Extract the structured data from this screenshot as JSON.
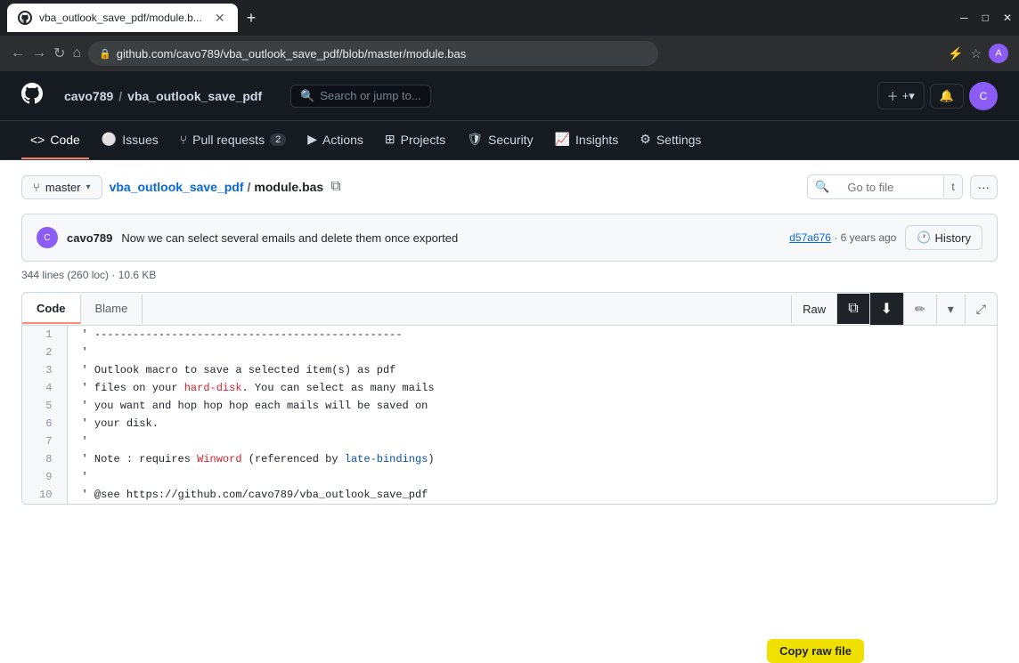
{
  "browser": {
    "tab_title": "vba_outlook_save_pdf/module.b...",
    "url": "github.com/cavo789/vba_outlook_save_pdf/blob/master/module.bas",
    "new_tab_label": "+"
  },
  "github": {
    "logo": "⬤",
    "breadcrumb_user": "cavo789",
    "breadcrumb_sep": "/",
    "breadcrumb_repo": "vba_outlook_save_pdf",
    "search_placeholder": "Search or jump to...",
    "header_icons": {
      "plus_label": "+▾",
      "bell_label": "🔔"
    }
  },
  "nav": {
    "items": [
      {
        "id": "code",
        "label": "Code",
        "active": true,
        "badge": null
      },
      {
        "id": "issues",
        "label": "Issues",
        "active": false,
        "badge": null
      },
      {
        "id": "pull_requests",
        "label": "Pull requests",
        "active": false,
        "badge": "2"
      },
      {
        "id": "actions",
        "label": "Actions",
        "active": false,
        "badge": null
      },
      {
        "id": "projects",
        "label": "Projects",
        "active": false,
        "badge": null
      },
      {
        "id": "security",
        "label": "Security",
        "active": false,
        "badge": null
      },
      {
        "id": "insights",
        "label": "Insights",
        "active": false,
        "badge": null
      },
      {
        "id": "settings",
        "label": "Settings",
        "active": false,
        "badge": null
      }
    ]
  },
  "file_nav": {
    "branch": "master",
    "repo_name": "vba_outlook_save_pdf",
    "file_name": "module.bas",
    "go_to_file_placeholder": "Go to file",
    "go_to_file_shortcut": "t"
  },
  "commit": {
    "author": "cavo789",
    "message": "Now we can select several emails and delete them once exported",
    "hash": "d57a676",
    "age": "6 years ago",
    "history_label": "History"
  },
  "file_meta": {
    "stats": "344 lines (260 loc) · 10.6 KB"
  },
  "toolbar": {
    "raw_label": "Raw",
    "copy_label": "📋",
    "download_label": "⬇",
    "edit_label": "✏",
    "more_label": "▾",
    "expand_label": "⤢",
    "code_tab": "Code",
    "blame_tab": "Blame",
    "copy_raw_tooltip": "Copy raw file"
  },
  "code_lines": [
    {
      "num": 1,
      "code": "' ------------------------------------------------"
    },
    {
      "num": 2,
      "code": "'"
    },
    {
      "num": 3,
      "code": "' Outlook macro to save a selected item(s) as pdf"
    },
    {
      "num": 4,
      "code": "' files on your hard-disk. You can select as many mails"
    },
    {
      "num": 5,
      "code": "' you want and hop hop hop each mails will be saved on"
    },
    {
      "num": 6,
      "code": "' your disk."
    },
    {
      "num": 7,
      "code": "'"
    },
    {
      "num": 8,
      "code": "' Note : requires Winword (referenced by late-bindings)"
    },
    {
      "num": 9,
      "code": "'"
    },
    {
      "num": 10,
      "code": "' @see https://github.com/cavo789/vba_outlook_save_pdf"
    }
  ]
}
